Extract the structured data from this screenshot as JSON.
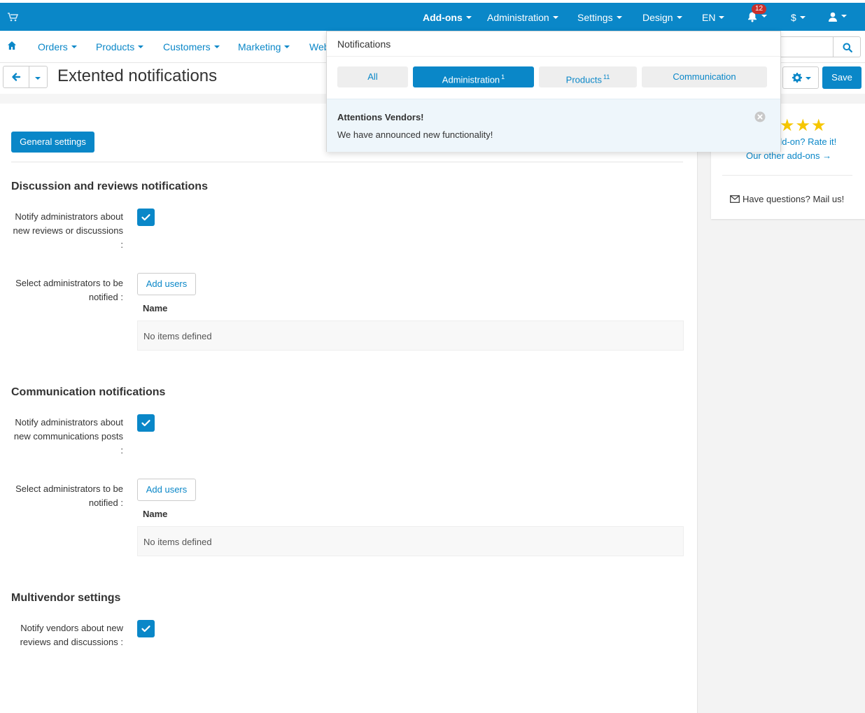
{
  "topbar": {
    "items": [
      {
        "label": "Add-ons"
      },
      {
        "label": "Administration"
      },
      {
        "label": "Settings"
      },
      {
        "label": "Design"
      },
      {
        "label": "EN"
      },
      {
        "label": "$"
      }
    ],
    "notifications_count": "12"
  },
  "secnav": {
    "items": [
      {
        "label": "Orders"
      },
      {
        "label": "Products"
      },
      {
        "label": "Customers"
      },
      {
        "label": "Marketing"
      },
      {
        "label": "Web"
      }
    ]
  },
  "header": {
    "title": "Extented notifications",
    "save_label": "Save"
  },
  "notifications": {
    "heading": "Notifications",
    "tabs": [
      {
        "label": "All",
        "count": ""
      },
      {
        "label": "Administration",
        "count": "1"
      },
      {
        "label": "Products",
        "count": "11"
      },
      {
        "label": "Communication",
        "count": ""
      }
    ],
    "active_tab": "Administration",
    "item": {
      "title": "Attentions Vendors!",
      "message": "We have announced new functionality!"
    }
  },
  "sidebar": {
    "rate_text": "dd-on? Rate it!",
    "other_addons": "Our other add-ons →",
    "mail_text": "Have questions? Mail us!"
  },
  "main": {
    "general_settings": "General settings",
    "sections": [
      {
        "title": "Discussion and reviews notifications",
        "notify_label": "Notify administrators about new reviews or discussions :",
        "select_label": "Select administrators to be notified :",
        "add_users": "Add users",
        "column_name": "Name",
        "empty_text": "No items defined"
      },
      {
        "title": "Communication notifications",
        "notify_label": "Notify administrators about new communications posts :",
        "select_label": "Select administrators to be notified :",
        "add_users": "Add users",
        "column_name": "Name",
        "empty_text": "No items defined"
      },
      {
        "title": "Multivendor settings",
        "notify_label": "Notify vendors about new reviews and discussions :"
      }
    ]
  },
  "colors": {
    "primary": "#0a87c8",
    "badge": "#c9302c",
    "star": "#f6c600"
  }
}
